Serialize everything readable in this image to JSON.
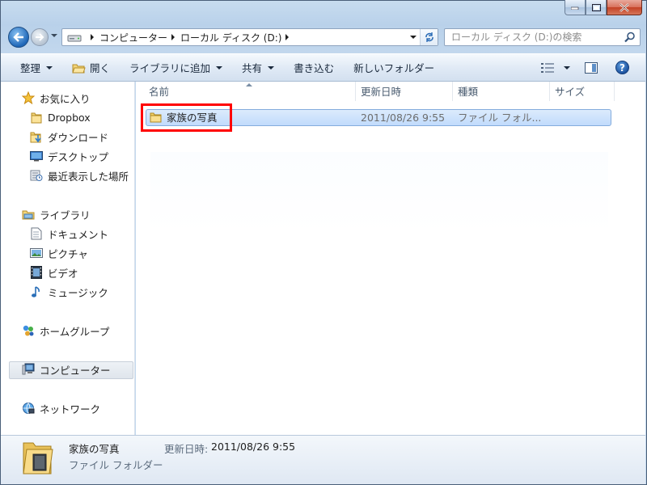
{
  "window": {
    "caption_buttons": [
      "minimize",
      "maximize",
      "close"
    ]
  },
  "address_bar": {
    "crumbs": [
      "コンピューター",
      "ローカル ディスク (D:)"
    ],
    "drive_icon": "drive-icon"
  },
  "search": {
    "placeholder": "ローカル ディスク (D:)の検索"
  },
  "toolbar": {
    "organize": "整理",
    "open": "開く",
    "include_library": "ライブラリに追加",
    "share": "共有",
    "burn": "書き込む",
    "new_folder": "新しいフォルダー",
    "help": "?"
  },
  "navigation": {
    "favorites": "お気に入り",
    "favorites_items": [
      "Dropbox",
      "ダウンロード",
      "デスクトップ",
      "最近表示した場所"
    ],
    "libraries": "ライブラリ",
    "libraries_items": [
      "ドキュメント",
      "ピクチャ",
      "ビデオ",
      "ミュージック"
    ],
    "homegroup": "ホームグループ",
    "computer": "コンピューター",
    "network": "ネットワーク"
  },
  "columns": {
    "name": "名前",
    "date": "更新日時",
    "type": "種類",
    "size": "サイズ"
  },
  "files": [
    {
      "name": "家族の写真",
      "date": "2011/08/26 9:55",
      "type": "ファイル フォル..."
    }
  ],
  "details": {
    "name": "家族の写真",
    "date_label": "更新日時:",
    "date_value": "2011/08/26 9:55",
    "type": "ファイル フォルダー"
  },
  "colors": {
    "selection": "#c1dbfc",
    "highlight_box": "#ff0000",
    "toolbar": "#dfe9f5"
  }
}
